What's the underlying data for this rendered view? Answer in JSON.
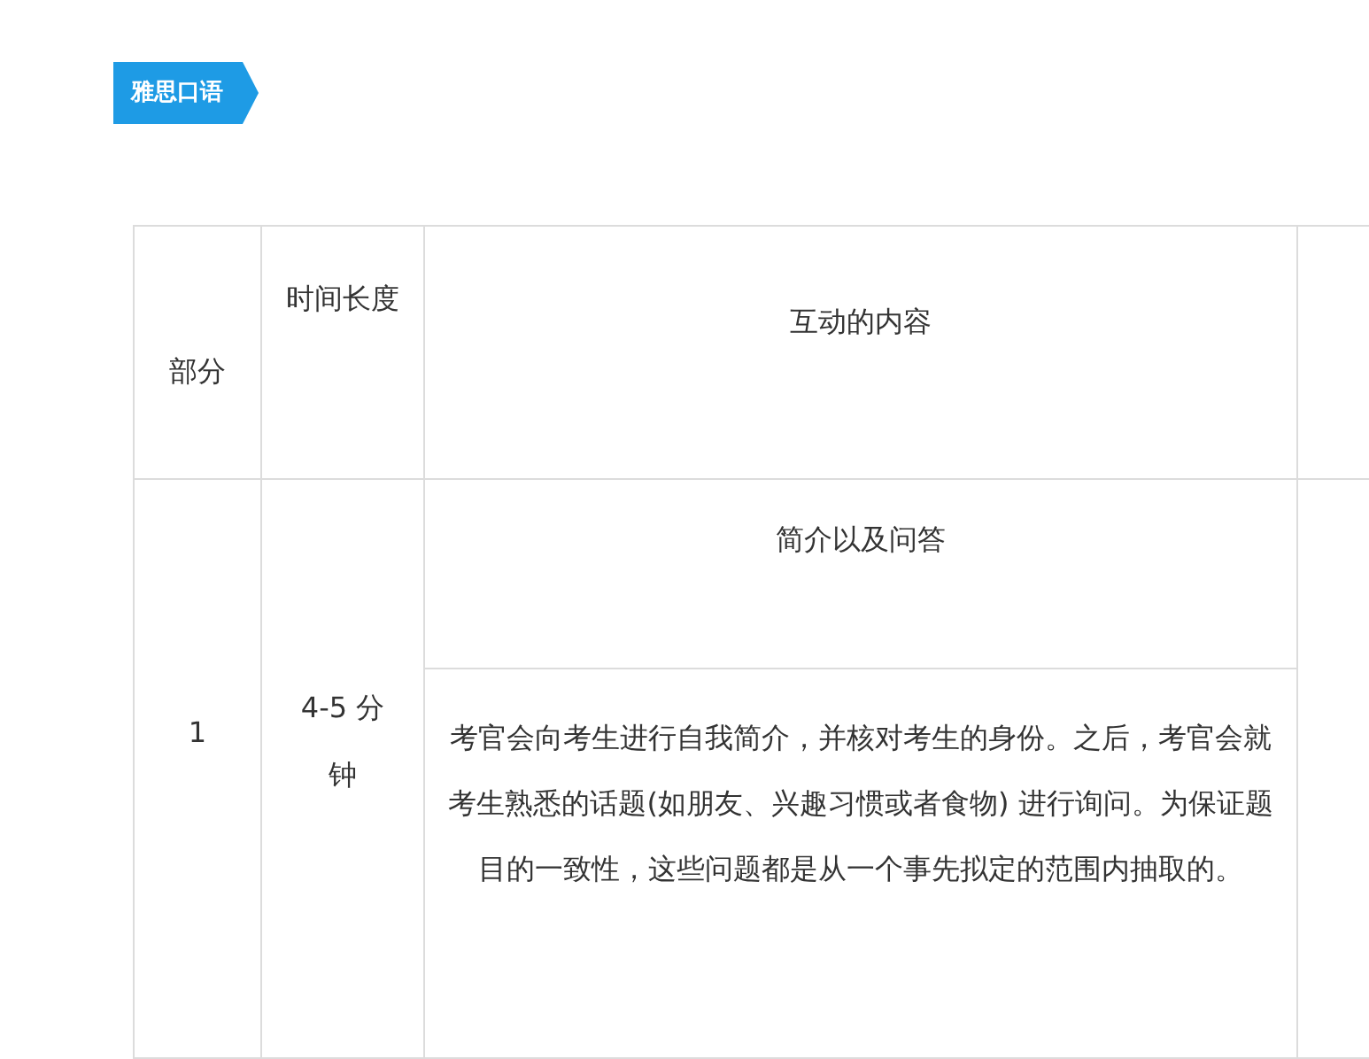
{
  "tag": "雅思口语",
  "table": {
    "columns": [
      "部分",
      "时间长度",
      "互动的内容"
    ],
    "rows": [
      {
        "part": "1",
        "duration": "4-5 分钟",
        "topic": "简介以及问答",
        "description": "考官会向考生进行自我简介，并核对考生的身份。之后，考官会就考生熟悉的话题(如朋友、兴趣习惯或者食物) 进行询问。为保证题目的一致性，这些问题都是从一个事先拟定的范围内抽取的。"
      }
    ]
  }
}
